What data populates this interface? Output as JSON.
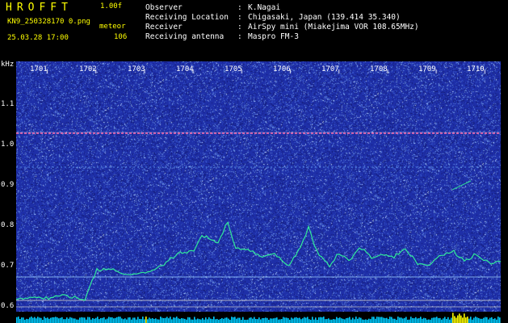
{
  "app": {
    "title": "HROFFT",
    "version": "1.00f",
    "filename": "KN9_250328170 0.png",
    "mode": "meteor",
    "datetime": "25.03.28 17:00",
    "count": "106"
  },
  "info": [
    {
      "label": "Observer",
      "value": "K.Nagai"
    },
    {
      "label": "Receiving Location",
      "value": "Chigasaki, Japan (139.414 35.340)"
    },
    {
      "label": "Receiver",
      "value": "AirSpy mini (Miakejima VOR 108.65MHz)"
    },
    {
      "label": "Receiving antenna",
      "value": "Maspro FM-3"
    }
  ],
  "separator": ":",
  "axis": {
    "unit": "kHz",
    "y_ticks": [
      "1.1",
      "1.0",
      "0.9",
      "0.8",
      "0.7",
      "0.6"
    ],
    "x_ticks": [
      "1701",
      "1702",
      "1703",
      "1704",
      "1705",
      "1706",
      "1707",
      "1708",
      "1709",
      "1710"
    ]
  },
  "colors": {
    "background": "#000000",
    "waterfall": "#1e2fa8",
    "text_yellow": "#ffff00",
    "text_white": "#ffffff",
    "carrier": "#ff66aa",
    "trace": "#33ff99",
    "strip": "#00ccff",
    "strip_hit": "#ffff00"
  }
}
